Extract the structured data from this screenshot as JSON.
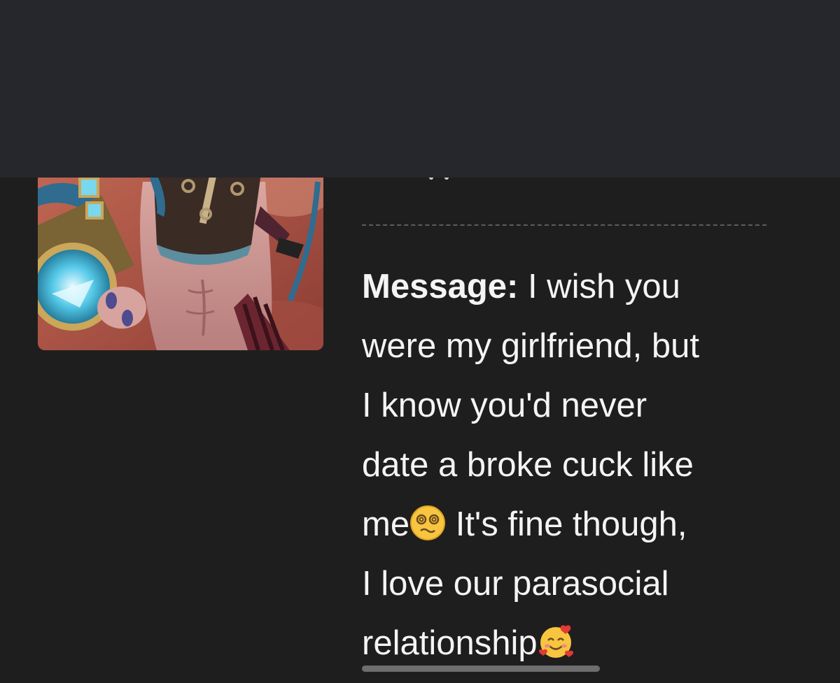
{
  "post": {
    "message_label": "Message:",
    "message_lines": [
      "I wish you",
      "were my girlfriend, but",
      "I know you'd never",
      "date a broke cuck like",
      "me",
      "It's fine though,",
      "I love our parasocial",
      "relationship"
    ],
    "emoji_1": "dizzy-face-emoji",
    "emoji_2": "smiling-face-with-hearts-emoji"
  },
  "colors": {
    "top_bar": "#26272c",
    "background": "#1f1e1e",
    "text": "#f4f4f4",
    "divider": "#5d5c5c"
  }
}
